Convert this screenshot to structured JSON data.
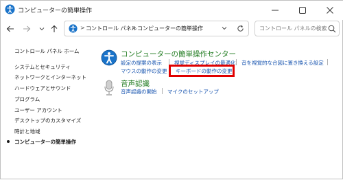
{
  "window": {
    "title": "コンピューターの簡単操作"
  },
  "address": {
    "crumbs": [
      "コントロール パネル",
      "コンピューターの簡単操作"
    ],
    "separator": ">"
  },
  "search": {
    "placeholder": "コントロール パネルの検索"
  },
  "sidebar": {
    "home": "コントロール パネル ホーム",
    "items": [
      "システムとセキュリティ",
      "ネットワークとインターネット",
      "ハードウェアとサウンド",
      "プログラム",
      "ユーザー アカウント",
      "デスクトップのカスタマイズ",
      "時計と地域",
      "コンピューターの簡単操作"
    ]
  },
  "categories": [
    {
      "title": "コンピューターの簡単操作センター",
      "icon": "ease-of-access-icon",
      "row1": [
        "設定の提案の表示",
        "視覚ディスプレイの最適化",
        "音を視覚的な合図に置き換える設定"
      ],
      "row2": [
        "マウスの動作の変更",
        "キーボードの動作の変更"
      ]
    },
    {
      "title": "音声認識",
      "icon": "microphone-icon",
      "row1": [
        "音声認識の開始",
        "マイクのセットアップ"
      ]
    }
  ],
  "colors": {
    "category_title": "#1e7a1e",
    "link": "#1a56b0",
    "highlight": "#e00000"
  }
}
